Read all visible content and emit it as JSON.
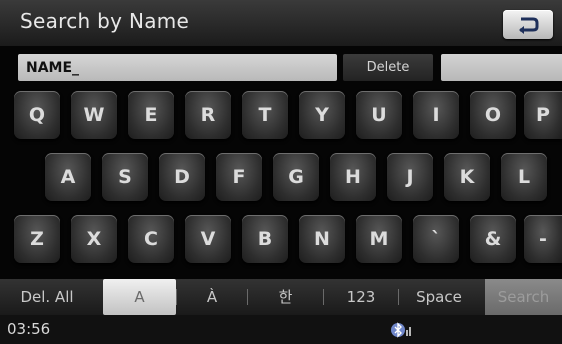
{
  "header": {
    "title": "Search by Name",
    "back_icon": "return-arrow-icon"
  },
  "input": {
    "value": "NAME_",
    "delete_label": "Delete",
    "secondary_value": ""
  },
  "keyboard": {
    "row1": [
      "Q",
      "W",
      "E",
      "R",
      "T",
      "Y",
      "U",
      "I",
      "O",
      "P"
    ],
    "row2": [
      "A",
      "S",
      "D",
      "F",
      "G",
      "H",
      "J",
      "K",
      "L"
    ],
    "row3": [
      "Z",
      "X",
      "C",
      "V",
      "B",
      "N",
      "M",
      "`",
      "&",
      "-"
    ]
  },
  "options": {
    "del_all": "Del. All",
    "upper": "A",
    "accent": "À",
    "korean": "한",
    "numbers": "123",
    "space": "Space",
    "search": "Search"
  },
  "status": {
    "time": "03:56",
    "bluetooth_icon": "bluetooth-icon"
  }
}
